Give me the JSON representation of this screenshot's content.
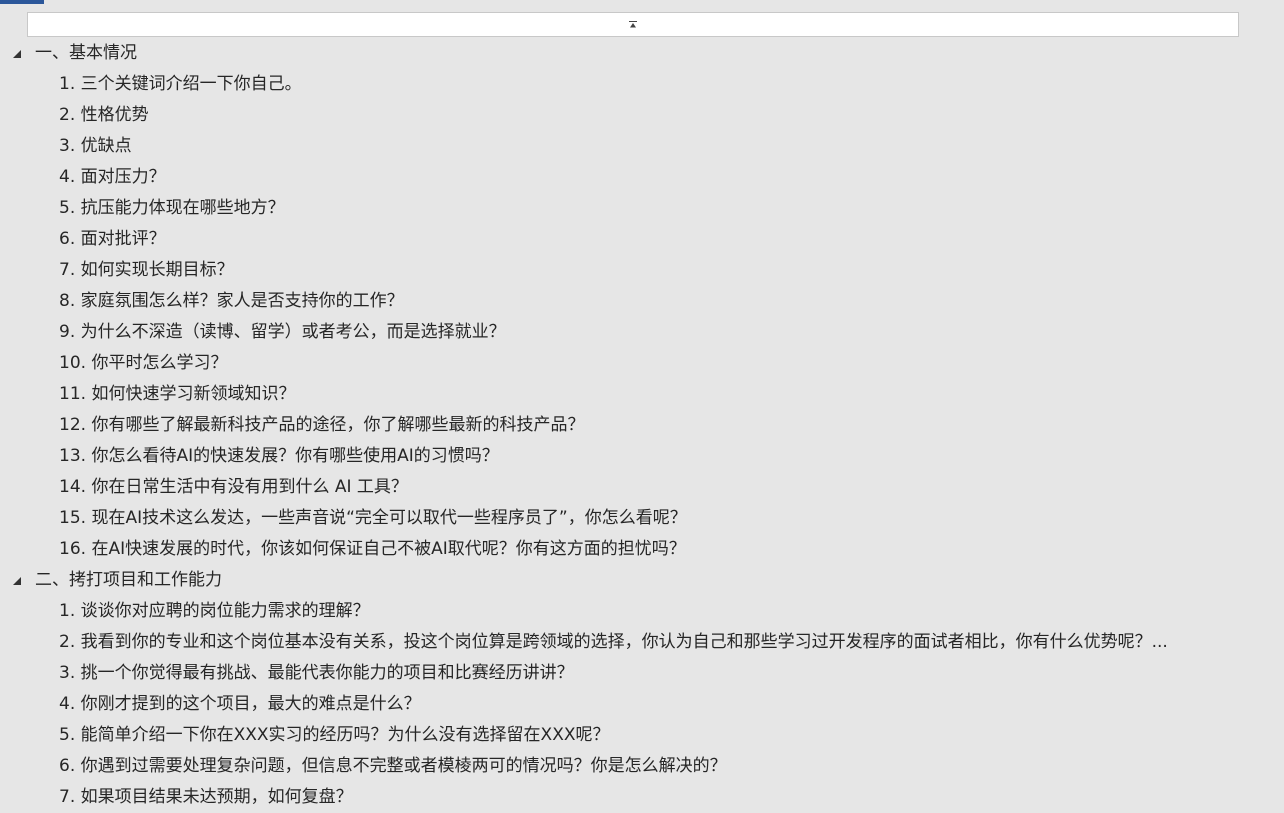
{
  "nav_pane": {
    "accent_color": "#2b579a",
    "collapse_icon": "collapse-up-icon",
    "expand_icon": "triangle-down-icon"
  },
  "sections": [
    {
      "heading": "一、基本情况",
      "items": [
        "1. 三个关键词介绍一下你自己。",
        "2. 性格优势",
        "3. 优缺点",
        "4. 面对压力？",
        "5. 抗压能力体现在哪些地方？",
        "6. 面对批评？",
        "7. 如何实现长期目标？",
        "8. 家庭氛围怎么样？家人是否支持你的工作？",
        "9. 为什么不深造（读博、留学）或者考公，而是选择就业？",
        "10. 你平时怎么学习？",
        "11. 如何快速学习新领域知识？",
        "12. 你有哪些了解最新科技产品的途径，你了解哪些最新的科技产品？",
        "13. 你怎么看待AI的快速发展？你有哪些使用AI的习惯吗？",
        "14. 你在日常生活中有没有用到什么 AI 工具？",
        "15. 现在AI技术这么发达，一些声音说“完全可以取代一些程序员了”，你怎么看呢？",
        "16. 在AI快速发展的时代，你该如何保证自己不被AI取代呢？你有这方面的担忧吗？"
      ]
    },
    {
      "heading": "二、拷打项目和工作能力",
      "items": [
        "1. 谈谈你对应聘的岗位能力需求的理解？",
        "2. 我看到你的专业和这个岗位基本没有关系，投这个岗位算是跨领域的选择，你认为自己和那些学习过开发程序的面试者相比，你有什么优势呢？...",
        "3. 挑一个你觉得最有挑战、最能代表你能力的项目和比赛经历讲讲？",
        "4. 你刚才提到的这个项目，最大的难点是什么？",
        "5. 能简单介绍一下你在XXX实习的经历吗？为什么没有选择留在XXX呢？",
        "6. 你遇到过需要处理复杂问题，但信息不完整或者模棱两可的情况吗？你是怎么解决的？",
        "7. 如果项目结果未达预期，如何复盘？"
      ]
    }
  ]
}
